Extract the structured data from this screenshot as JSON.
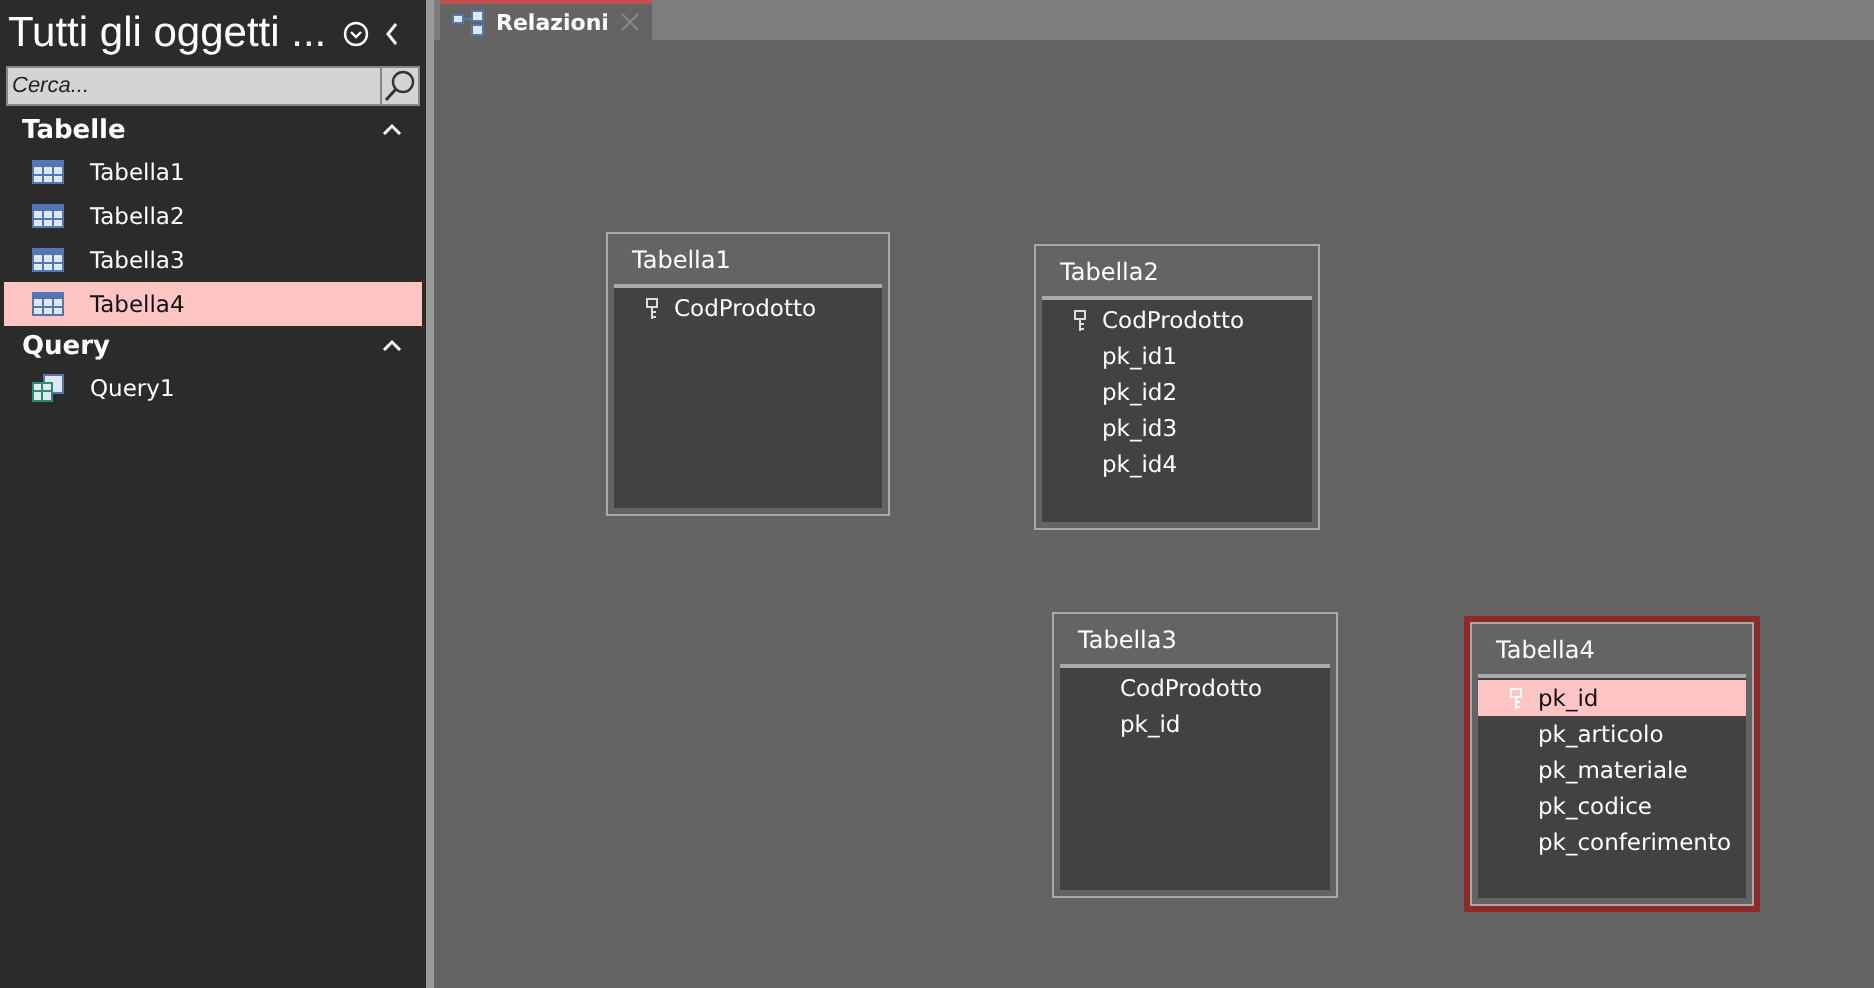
{
  "nav_pane": {
    "title": "Tutti gli oggetti ...",
    "search": {
      "placeholder": "Cerca..."
    },
    "groups": [
      {
        "label": "Tabelle",
        "expanded": true,
        "items": [
          {
            "label": "Tabella1",
            "kind": "table",
            "selected": false
          },
          {
            "label": "Tabella2",
            "kind": "table",
            "selected": false
          },
          {
            "label": "Tabella3",
            "kind": "table",
            "selected": false
          },
          {
            "label": "Tabella4",
            "kind": "table",
            "selected": true
          }
        ]
      },
      {
        "label": "Query",
        "expanded": true,
        "items": [
          {
            "label": "Query1",
            "kind": "query",
            "selected": false
          }
        ]
      }
    ]
  },
  "tabs": [
    {
      "label": "Relazioni",
      "selected": true
    }
  ],
  "tables": [
    {
      "title": "Tabella1",
      "selected": false,
      "fields": [
        {
          "name": "CodProdotto",
          "key": true,
          "selected": false
        }
      ]
    },
    {
      "title": "Tabella2",
      "selected": false,
      "fields": [
        {
          "name": "CodProdotto",
          "key": true,
          "selected": false
        },
        {
          "name": "pk_id1",
          "key": false,
          "selected": false
        },
        {
          "name": "pk_id2",
          "key": false,
          "selected": false
        },
        {
          "name": "pk_id3",
          "key": false,
          "selected": false
        },
        {
          "name": "pk_id4",
          "key": false,
          "selected": false
        }
      ]
    },
    {
      "title": "Tabella3",
      "selected": false,
      "fields": [
        {
          "name": "CodProdotto",
          "key": false,
          "selected": false
        },
        {
          "name": "pk_id",
          "key": false,
          "selected": false
        }
      ]
    },
    {
      "title": "Tabella4",
      "selected": true,
      "fields": [
        {
          "name": "pk_id",
          "key": true,
          "selected": true
        },
        {
          "name": "pk_articolo",
          "key": false,
          "selected": false
        },
        {
          "name": "pk_materiale",
          "key": false,
          "selected": false
        },
        {
          "name": "pk_codice",
          "key": false,
          "selected": false
        },
        {
          "name": "pk_conferimento",
          "key": false,
          "selected": false
        }
      ]
    }
  ]
}
